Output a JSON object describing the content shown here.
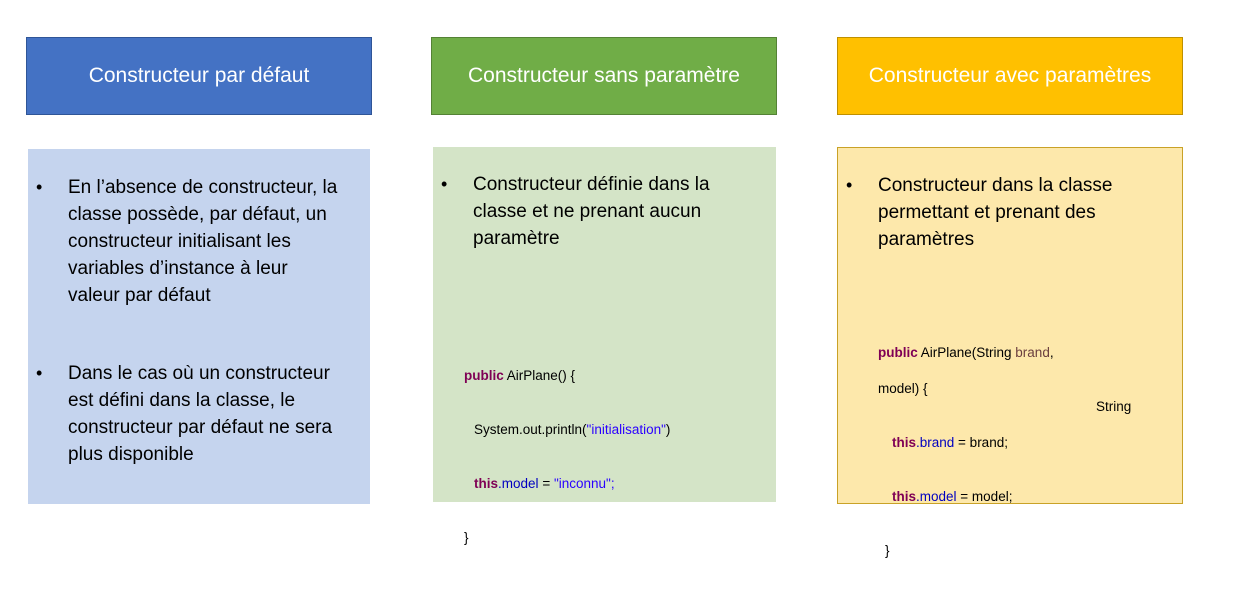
{
  "columns": [
    {
      "title": "Constructeur par défaut",
      "color": "#4472c4",
      "card_color": "#c5d4ee",
      "bullets": [
        "En l’absence de constructeur, la\nclasse possède, par défaut, un\nconstructeur initialisant les\nvariables d’instance à leur\nvaleur par défaut",
        "Dans le cas où un constructeur\nest défini dans la classe, le\nconstructeur par défaut ne sera\nplus disponible"
      ]
    },
    {
      "title": "Constructeur sans paramètre",
      "color": "#70ad47",
      "card_color": "#d4e4c7",
      "bullets": [
        "Constructeur définie dans la\nclasse et ne prenant aucun\nparamètre"
      ],
      "code": {
        "l1_kw": "public",
        "l1_rest": " AirPlane() {",
        "l2_pre": "System.out.println(",
        "l2_str": "\"initialisation\"",
        "l2_post": ")",
        "l3_kw": "this",
        "l3_dot": ".",
        "l3_fld": "model",
        "l3_eq": " = ",
        "l3_str": "\"inconnu\"",
        "l3_semi": ";",
        "l4": "}"
      }
    },
    {
      "title": "Constructeur avec paramètres",
      "color": "#ffc000",
      "card_color": "#fde8ab",
      "bullets": [
        "Constructeur dans la classe\npermettant et prenant des\nparamètres"
      ],
      "code": {
        "l1_kw": "public",
        "l1_rest": " AirPlane(String ",
        "l1_par": "brand",
        "l1_comma": ",",
        "l2": "String",
        "l3": "model) {",
        "l4_kw": "this",
        "l4_fld": ".brand",
        "l4_rest": " = brand;",
        "l5_kw": "this",
        "l5_fld": ".model",
        "l5_rest": " = model;",
        "l6": "}"
      }
    }
  ]
}
